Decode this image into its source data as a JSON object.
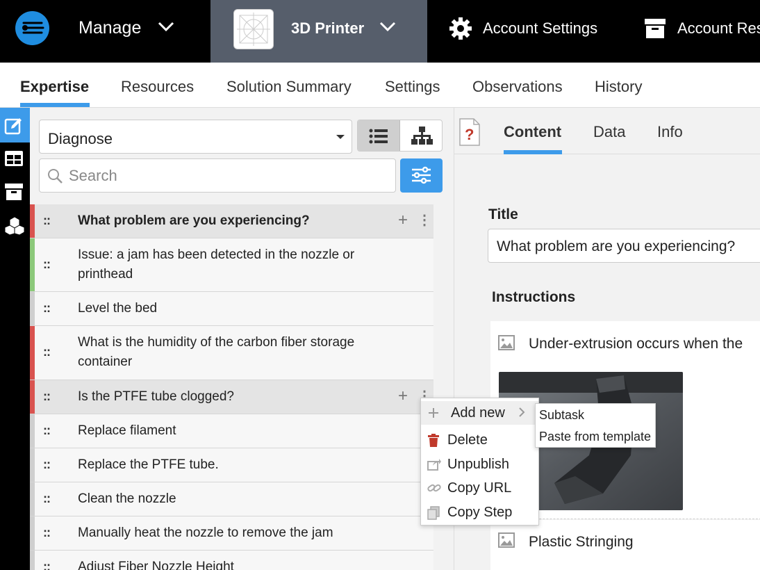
{
  "topbar": {
    "manage_label": "Manage",
    "product_name": "3D Printer",
    "account_settings_label": "Account Settings",
    "account_resources_label": "Account Res"
  },
  "tabs": [
    {
      "label": "Expertise",
      "active": true
    },
    {
      "label": "Resources"
    },
    {
      "label": "Solution Summary"
    },
    {
      "label": "Settings"
    },
    {
      "label": "Observations"
    },
    {
      "label": "History"
    }
  ],
  "left_strip": {
    "icons": [
      "edit-icon",
      "table-icon",
      "archive-icon",
      "cubes-icon"
    ]
  },
  "left_panel": {
    "mode_select_value": "Diagnose",
    "search_placeholder": "Search",
    "steps": [
      {
        "text": "What problem are you experiencing?",
        "bold": true,
        "status_color": "#d9534f",
        "selected": true
      },
      {
        "text": "Issue: a jam has been detected in the nozzle or printhead",
        "status_color": "#5cb85c"
      },
      {
        "text": "Level the bed",
        "status_color": ""
      },
      {
        "text": "What is the humidity of the carbon fiber storage container",
        "status_color": "#d9534f"
      },
      {
        "text": "Is the PTFE tube clogged?",
        "status_color": "#d9534f",
        "selected": true
      },
      {
        "text": "Replace filament",
        "status_color": ""
      },
      {
        "text": "Replace the PTFE tube.",
        "status_color": ""
      },
      {
        "text": "Clean the nozzle",
        "status_color": ""
      },
      {
        "text": "Manually heat the nozzle to remove the jam",
        "status_color": ""
      },
      {
        "text": "Adjust Fiber Nozzle Height",
        "status_color": ""
      }
    ]
  },
  "context_menu": {
    "items": [
      {
        "label": "Add new",
        "icon": "plus-icon"
      },
      {
        "label": "Delete",
        "icon": "trash-icon"
      },
      {
        "label": "Unpublish",
        "icon": "unpublish-icon"
      },
      {
        "label": "Copy URL",
        "icon": "link-icon"
      },
      {
        "label": "Copy Step",
        "icon": "copy-icon"
      }
    ],
    "submenu": [
      "Subtask",
      "Paste from template"
    ]
  },
  "right_panel": {
    "tabs": [
      {
        "label": "Content",
        "active": true
      },
      {
        "label": "Data"
      },
      {
        "label": "Info"
      }
    ],
    "title_label": "Title",
    "title_value": "What problem are you experiencing?",
    "instructions_label": "Instructions",
    "instructions": [
      "Under-extrusion occurs when the",
      "Plastic Stringing"
    ]
  },
  "colors": {
    "accent": "#3d9bea",
    "topbar_bg": "#000000",
    "product_bg": "#565e6b",
    "danger": "#c0392b"
  }
}
